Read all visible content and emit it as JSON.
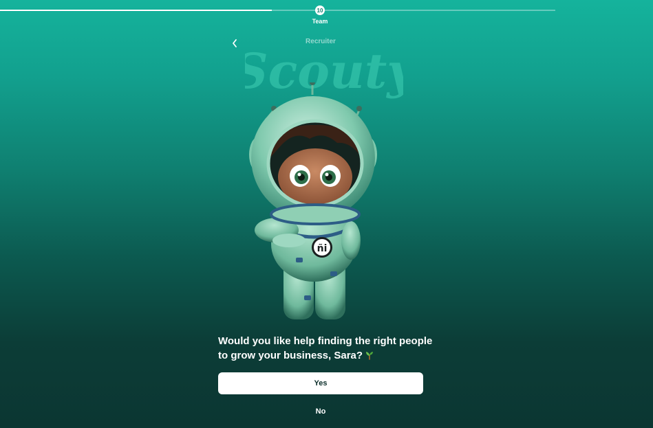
{
  "progress": {
    "step_number": "10",
    "step_label": "Team",
    "completed_fraction": 0.49
  },
  "header": {
    "role_label": "Recruiter",
    "brand_name": "Scouty",
    "back_icon": "chevron-left-icon"
  },
  "prompt": {
    "question": "Would you like help finding the right people to grow your business, Sara?",
    "emoji_icon": "seedling-icon"
  },
  "actions": {
    "yes_label": "Yes",
    "no_label": "No"
  },
  "colors": {
    "gradient_top": "#15b39c",
    "gradient_bottom": "#0b3632",
    "button_bg": "#ffffff",
    "button_text": "#0b2e2a"
  }
}
